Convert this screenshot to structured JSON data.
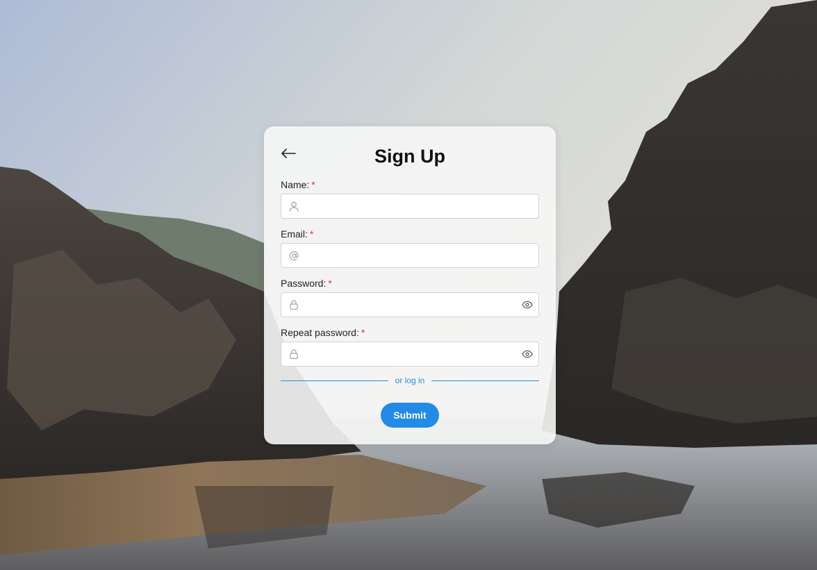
{
  "page": {
    "title": "Sign Up",
    "accent_color": "#228be6",
    "required_color": "#e03131"
  },
  "form": {
    "back_icon": "arrow-left-icon",
    "fields": [
      {
        "label": "Name:",
        "required_mark": "*",
        "value": "",
        "icon": "user-icon"
      },
      {
        "label": "Email:",
        "required_mark": "*",
        "value": "",
        "icon": "at-icon"
      },
      {
        "label": "Password:",
        "required_mark": "*",
        "value": "",
        "icon": "lock-icon",
        "toggle_icon": "eye-icon"
      },
      {
        "label": "Repeat password:",
        "required_mark": "*",
        "value": "",
        "icon": "lock-icon",
        "toggle_icon": "eye-icon"
      }
    ],
    "login_link": "or log in",
    "submit_label": "Submit"
  }
}
